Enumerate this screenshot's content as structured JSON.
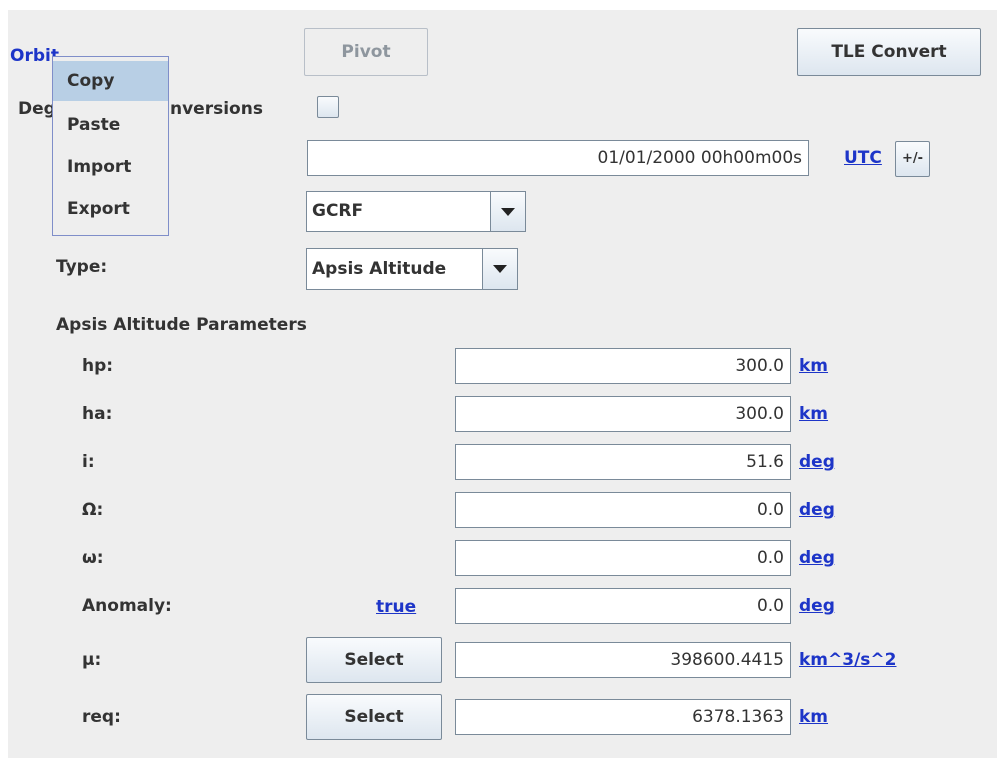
{
  "header": {
    "orbit_label": "Orbit",
    "degrees_label_left": "Deg",
    "degrees_label_right": "nversions",
    "pivot_button": "Pivot",
    "tle_button": "TLE Convert"
  },
  "date": {
    "value": "01/01/2000 00h00m00s",
    "timescale": "UTC",
    "plusminus": "+/-"
  },
  "frame": {
    "selected": "GCRF"
  },
  "type": {
    "label": "Type:",
    "selected": "Apsis Altitude"
  },
  "section_title": "Apsis Altitude Parameters",
  "params": {
    "hp": {
      "label": "hp:",
      "value": "300.0",
      "unit": "km"
    },
    "ha": {
      "label": "ha:",
      "value": "300.0",
      "unit": "km"
    },
    "i": {
      "label": "i:",
      "value": "51.6",
      "unit": "deg"
    },
    "raan": {
      "label": "Ω:",
      "value": "0.0",
      "unit": "deg"
    },
    "argp": {
      "label": "ω:",
      "value": "0.0",
      "unit": "deg"
    },
    "anomaly": {
      "label": "Anomaly:",
      "kind": "true",
      "value": "0.0",
      "unit": "deg"
    },
    "mu": {
      "label": "µ:",
      "button": "Select",
      "value": "398600.4415",
      "unit": "km^3/s^2"
    },
    "req": {
      "label": "req:",
      "button": "Select",
      "value": "6378.1363",
      "unit": "km"
    }
  },
  "context_menu": {
    "items": [
      "Copy",
      "Paste",
      "Import",
      "Export"
    ],
    "highlighted": "Copy"
  }
}
